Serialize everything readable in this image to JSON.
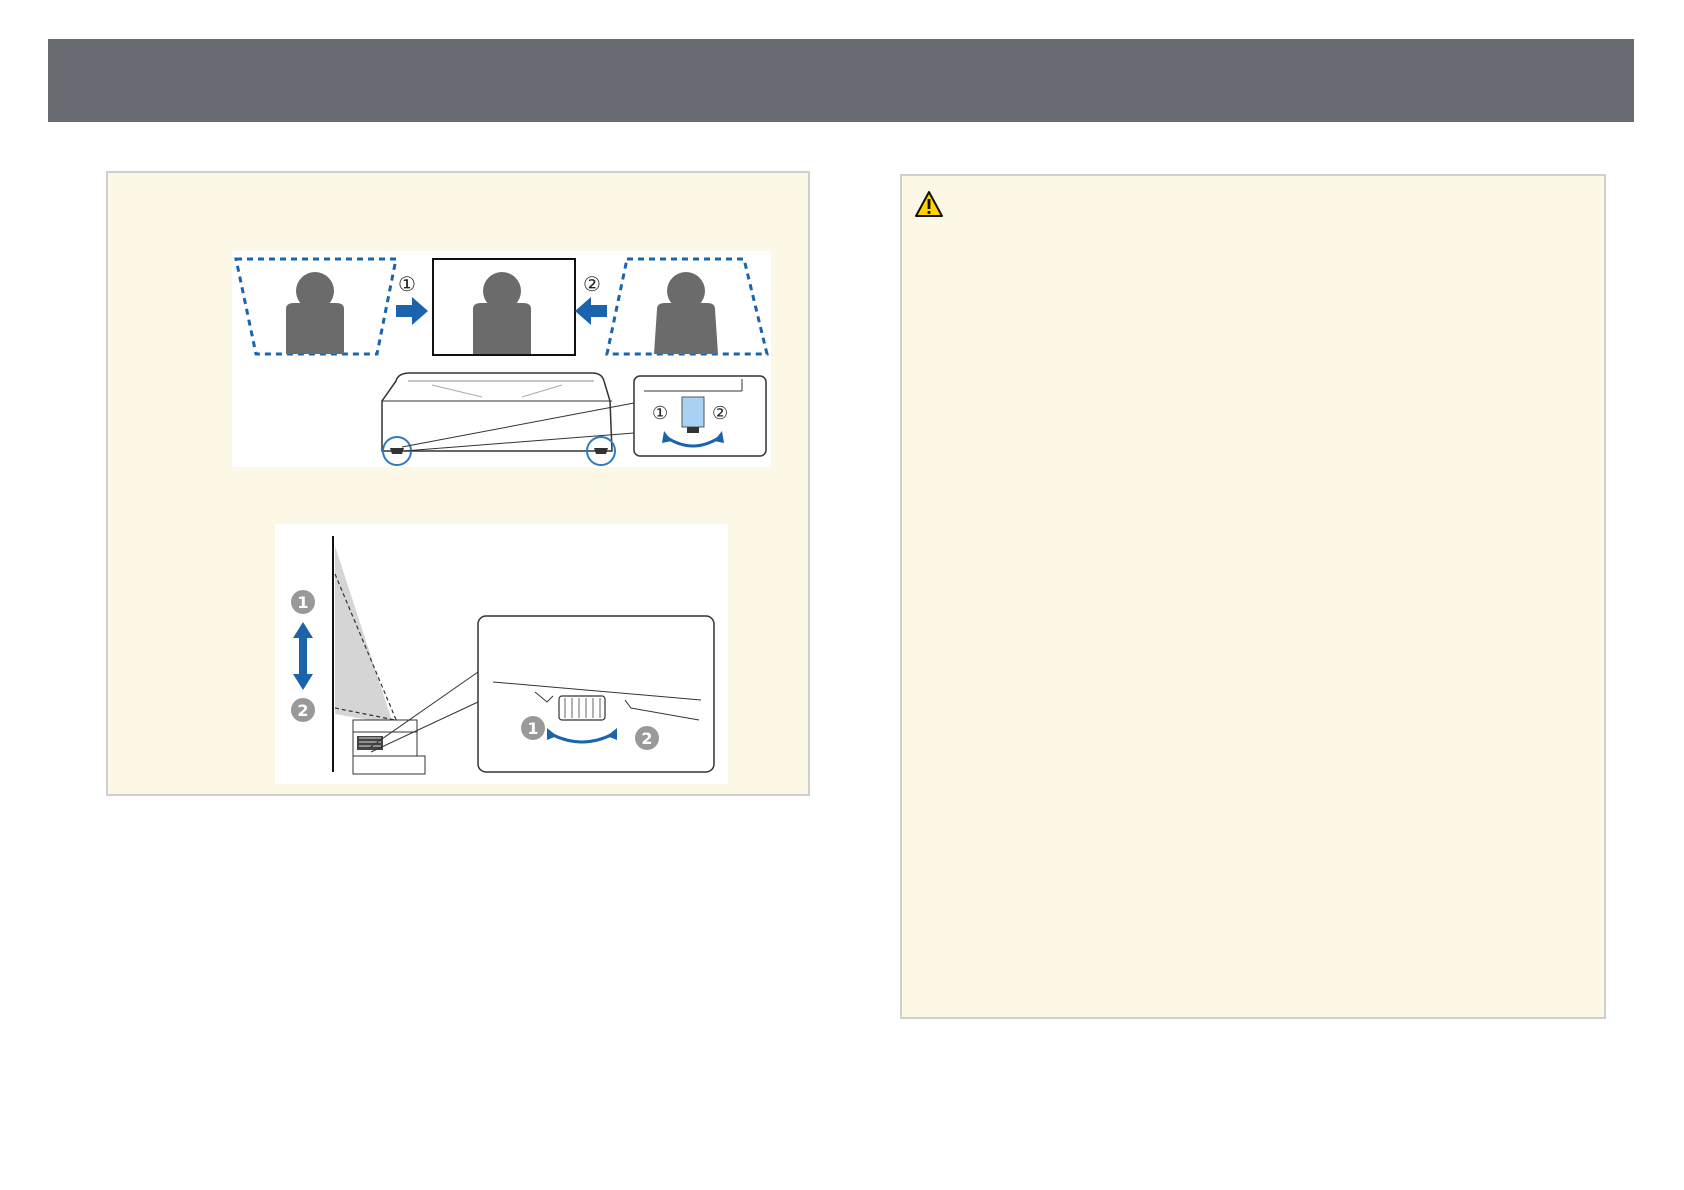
{
  "colors": {
    "header": "#686b72",
    "note_background": "#fdf8e6",
    "border": "#cfcfcf",
    "arrow_blue": "#1a64ad",
    "foot_blue": "#2e7bc4",
    "silhouette_gray": "#6b6b6b",
    "warning_yellow": "#ffd200"
  },
  "icons": {
    "warning": "warning-triangle-icon"
  },
  "figure_top": {
    "step_1": "①",
    "step_2": "②"
  },
  "figure_bottom": {
    "step_1": "1",
    "step_2": "2"
  }
}
